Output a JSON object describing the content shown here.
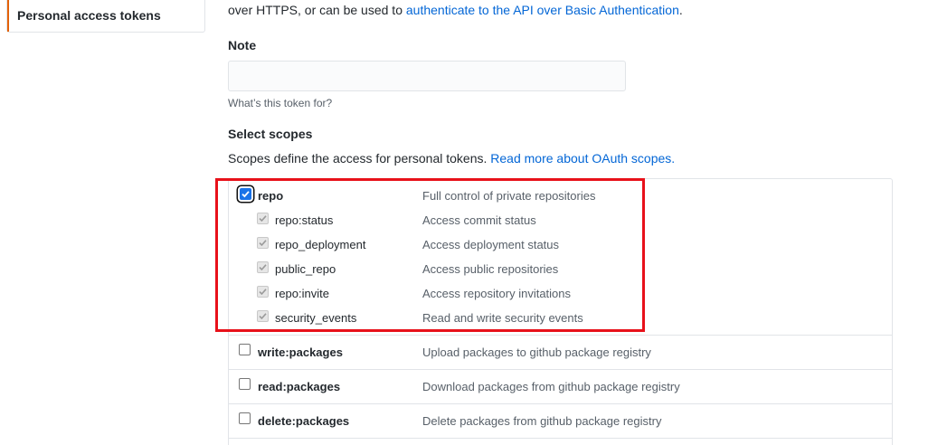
{
  "sidebar": {
    "active_item": "Personal access tokens"
  },
  "intro": {
    "prefix": "over HTTPS, or can be used to ",
    "link": "authenticate to the API over Basic Authentication",
    "suffix": "."
  },
  "note": {
    "label": "Note",
    "value": "",
    "placeholder": "",
    "hint": "What’s this token for?"
  },
  "scopes": {
    "label": "Select scopes",
    "desc_prefix": "Scopes define the access for personal tokens. ",
    "desc_link": "Read more about OAuth scopes.",
    "items": [
      {
        "name": "repo",
        "desc": "Full control of private repositories",
        "checked": true
      },
      {
        "name": "repo:status",
        "desc": "Access commit status",
        "checked": true
      },
      {
        "name": "repo_deployment",
        "desc": "Access deployment status",
        "checked": true
      },
      {
        "name": "public_repo",
        "desc": "Access public repositories",
        "checked": true
      },
      {
        "name": "repo:invite",
        "desc": "Access repository invitations",
        "checked": true
      },
      {
        "name": "security_events",
        "desc": "Read and write security events",
        "checked": true
      },
      {
        "name": "write:packages",
        "desc": "Upload packages to github package registry",
        "checked": false
      },
      {
        "name": "read:packages",
        "desc": "Download packages from github package registry",
        "checked": false
      },
      {
        "name": "delete:packages",
        "desc": "Delete packages from github package registry",
        "checked": false
      }
    ]
  },
  "colors": {
    "link": "#0366d6",
    "active_accent": "#e36209",
    "highlight": "#e8111a",
    "checkbox_checked": "#1a73e8"
  }
}
